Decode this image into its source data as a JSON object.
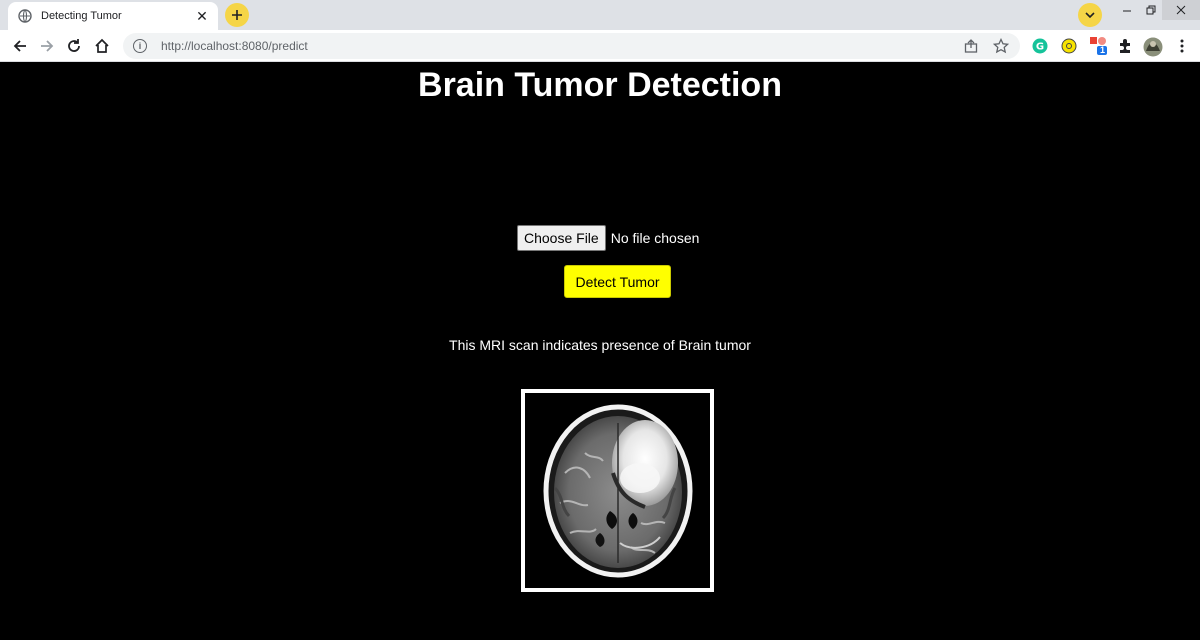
{
  "browser": {
    "tab_title": "Detecting Tumor",
    "url": "http://localhost:8080/predict",
    "accent": "#f5d547"
  },
  "page": {
    "title": "Brain Tumor Detection",
    "file_input": {
      "button_label": "Choose File",
      "status": "No file chosen"
    },
    "detect_button_label": "Detect Tumor",
    "detect_button_color": "#ffff00",
    "result_text": "This MRI scan indicates presence of Brain tumor"
  },
  "extensions": {
    "grammarly_badge": "1"
  }
}
